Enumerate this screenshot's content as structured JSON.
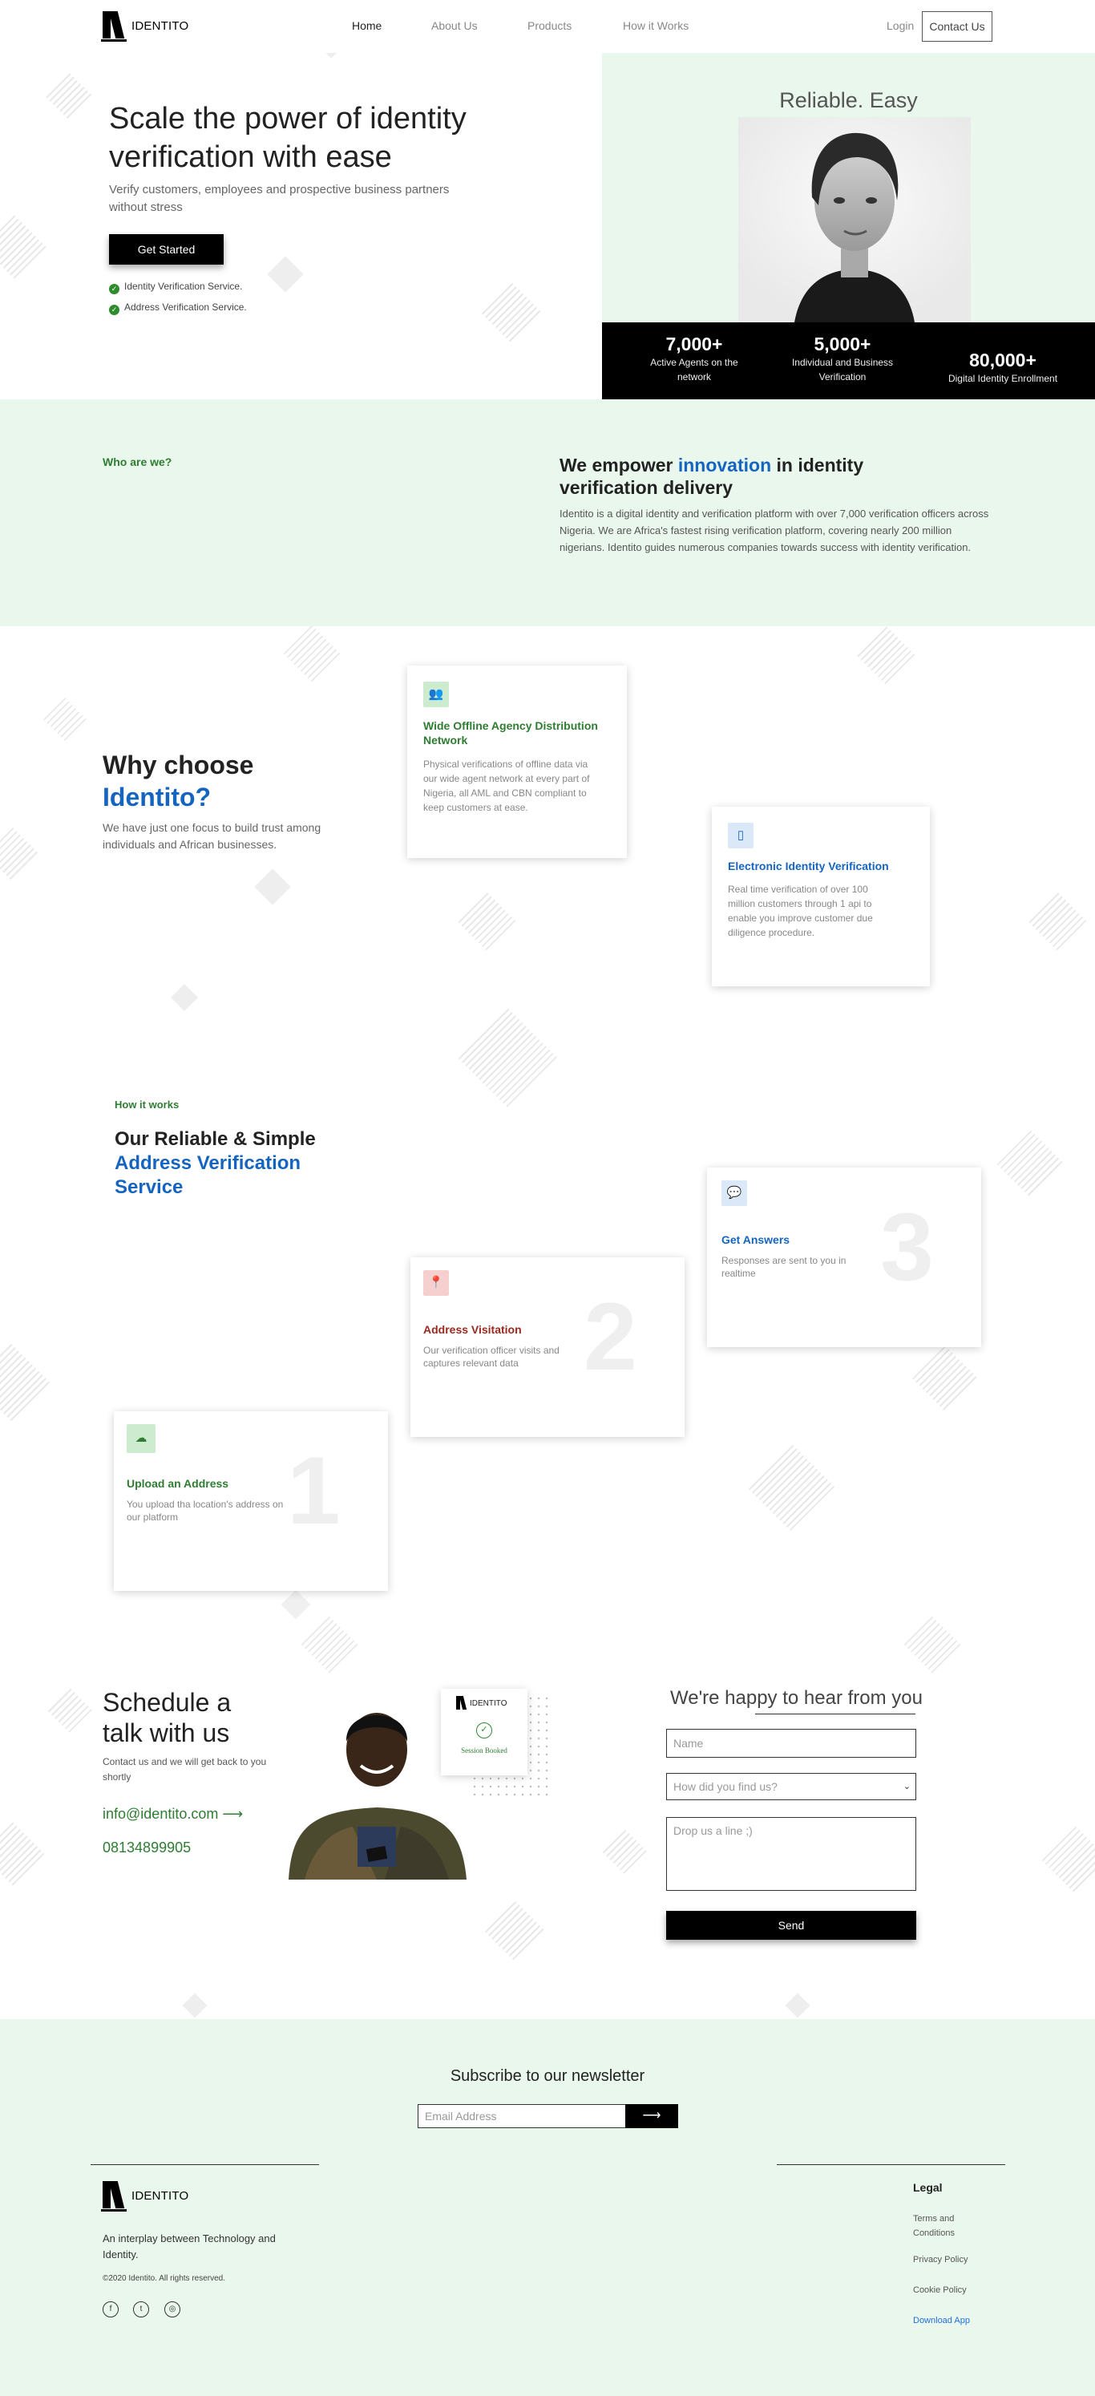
{
  "nav": {
    "logo_text": "IDENTITO",
    "links": [
      "Home",
      "About Us",
      "Products",
      "How it Works"
    ],
    "login": "Login",
    "contact": "Contact Us"
  },
  "hero": {
    "title": "Scale the power of identity verification with ease",
    "subtitle": "Verify customers, employees and prospective business partners without stress",
    "cta": "Get Started",
    "checks": [
      "Identity Verification Service.",
      "Address Verification Service."
    ],
    "tagline": "Reliable. Easy",
    "stats": [
      {
        "value": "7,000+",
        "label": "Active Agents on the network"
      },
      {
        "value": "5,000+",
        "label": "Individual and Business Verification"
      },
      {
        "value": "80,000+",
        "label": "Digital Identity Enrollment"
      }
    ]
  },
  "about": {
    "eyebrow": "Who are we?",
    "heading_pre": "We empower ",
    "heading_accent": "innovation",
    "heading_post": " in identity verification delivery",
    "body": "Identito is a digital identity and verification platform with over 7,000 verification officers across Nigeria. We are Africa's fastest rising verification platform, covering nearly 200 million nigerians. Identito guides numerous companies towards success with identity verification."
  },
  "why": {
    "title_line1": "Why choose",
    "title_line2": "Identito?",
    "body": "We have just one focus to build trust among individuals and African businesses.",
    "cards": [
      {
        "icon": "people-icon",
        "title": "Wide Offline Agency Distribution Network",
        "body": "Physical verifications of offline data via our wide agent network at every part of Nigeria, all AML and CBN compliant to keep customers at ease."
      },
      {
        "icon": "phone-icon",
        "title": "Electronic Identity Verification",
        "body": "Real time verification of over 100 million customers through 1 api to enable you improve customer due diligence procedure."
      }
    ]
  },
  "how": {
    "eyebrow": "How it works",
    "title_line1": "Our Reliable & Simple",
    "title_line2": "Address Verification",
    "title_line3": "Service",
    "steps": [
      {
        "num": "1",
        "icon": "cloud-upload-icon",
        "title": "Upload an Address",
        "body": "You upload tha location's address on our platform"
      },
      {
        "num": "2",
        "icon": "location-pin-icon",
        "title": "Address Visitation",
        "body": "Our verification officer visits and captures relevant data"
      },
      {
        "num": "3",
        "icon": "chat-icon",
        "title": "Get Answers",
        "body": "Responses are sent to you in realtime"
      }
    ]
  },
  "schedule": {
    "title_line1": "Schedule a",
    "title_line2": "talk with us",
    "body": "Contact us and we will get back to you shortly",
    "email": "info@identito.com",
    "phone": "08134899905",
    "badge_logo": "IDENTITO",
    "badge_text": "Session Booked"
  },
  "form": {
    "heading": "We're happy to hear from you",
    "name_placeholder": "Name",
    "select_value": "How did you find us?",
    "message_placeholder": "Drop us a line ;)",
    "send": "Send"
  },
  "newsletter": {
    "title": "Subscribe to our newsletter",
    "placeholder": "Email Address",
    "arrow": "⟶"
  },
  "footer": {
    "logo_text": "IDENTITO",
    "tagline": "An interplay between Technology and Identity.",
    "copyright": "©2020 Identito. All rights reserved.",
    "legal_title": "Legal",
    "legal_links": [
      "Terms and Conditions",
      "Privacy Policy",
      "Cookie Policy",
      "Download App"
    ]
  },
  "colors": {
    "green": "#2e7d32",
    "blue": "#1565c0",
    "red": "#9a2a1f",
    "mint": "#eaf7ec"
  }
}
